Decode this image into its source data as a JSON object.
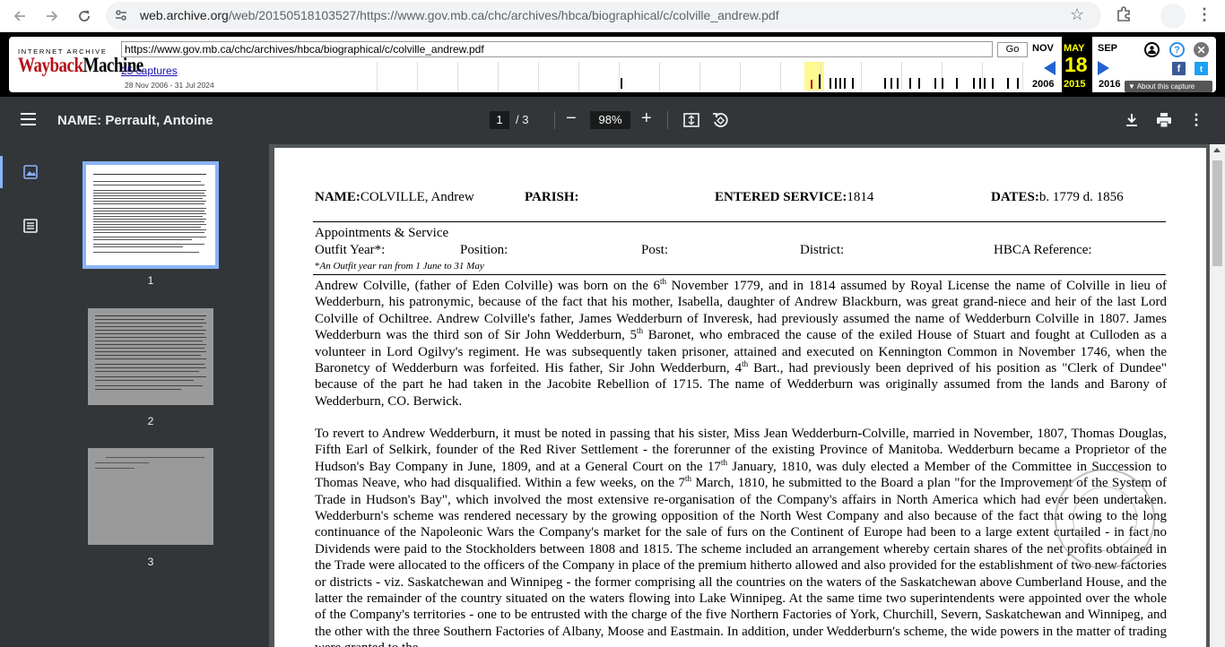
{
  "browser": {
    "url_host": "web.archive.org",
    "url_path": "/web/20150518103527/https://www.gov.mb.ca/chc/archives/hbca/biographical/c/colville_andrew.pdf"
  },
  "wayback": {
    "ia_label": "INTERNET ARCHIVE",
    "logo_red": "Wayback",
    "logo_black": "Machine",
    "url_value": "https://www.gov.mb.ca/chc/archives/hbca/biographical/c/colville_andrew.pdf",
    "go_label": "Go",
    "captures_label": "25 captures",
    "range_label": "28 Nov 2006 - 31 Jul 2024",
    "prev_month": "NOV",
    "cur_month": "MAY",
    "next_month": "SEP",
    "prev_year": "2006",
    "cur_day": "18",
    "cur_year": "2015",
    "next_year": "2016",
    "about_label": "▼ About this capture"
  },
  "pdf_toolbar": {
    "title": "NAME: Perrault, Antoine",
    "current_page": "1",
    "page_total": "/  3",
    "zoom": "98%"
  },
  "sidebar": {
    "thumbs": [
      {
        "num": "1"
      },
      {
        "num": "2"
      },
      {
        "num": "3"
      }
    ]
  },
  "document": {
    "name_label": "NAME:",
    "name_value": "COLVILLE, Andrew",
    "parish_label": "PARISH:",
    "entered_label": "ENTERED SERVICE:",
    "entered_value": "1814",
    "dates_label": "DATES:",
    "dates_value": "b. 1779 d. 1856",
    "appointments": "Appointments & Service",
    "col_outfit": "Outfit Year*:",
    "col_position": "Position:",
    "col_post": "Post:",
    "col_district": "District:",
    "col_ref": "HBCA Reference:",
    "note_ast": "*",
    "note": "An Outfit year ran from 1 June to 31 May",
    "p1": [
      "Andrew Colville, (father of Eden Colville) was born on the 6",
      "th",
      " November 1779, and in 1814 assumed by Royal License the name of Colville in lieu of Wedderburn, his patronymic, because of the fact that his mother, Isabella, daughter of Andrew Blackburn, was great grand-niece and heir of the last Lord Colville of Ochiltree.  Andrew Colville's father, James Wedderburn of Inveresk, had previously assumed the name of Wedderburn Colville in 1807.  James Wedderburn was the third  son of Sir John Wedderburn, 5",
      "th",
      " Baronet, who embraced the cause of the exiled House of Stuart and fought at Culloden as a volunteer in Lord Ogilvy's regiment.  He was subsequently taken prisoner, attained and executed on Kennington Common in November 1746, when the Baronetcy of Wedderburn was forfeited.  His father, Sir John Wedderburn, 4",
      "th",
      " Bart., had previously been deprived of his position as \"Clerk of Dundee\" because of the part he had taken in the Jacobite Rebellion of 1715.  The name of Wedderburn was originally assumed from the lands and Barony of Wedderburn, CO.  Berwick."
    ],
    "p2": [
      "To revert to Andrew Wedderburn, it must be noted in passing that his sister, Miss Jean Wedderburn-Colville, married in November, 1807, Thomas Douglas, Fifth Earl of Selkirk, founder of the Red River Settlement - the forerunner of the existing Province of Manitoba.  Wedderburn became a Proprietor of the Hudson's Bay Company in June, 1809, and at a General Court on the 17",
      "th",
      " January, 1810, was duly elected a Member of the Committee in Succession to Thomas Neave, who had disqualified.  Within a few weeks, on the 7",
      "th",
      " March, 1810, he submitted to the Board a plan \"for the Improvement of the System of Trade in Hudson's Bay\", which involved the most extensive re-organisation of the Company's affairs in North America which had ever been undertaken.  Wedderburn's scheme was rendered necessary by the growing opposition of the North West Company and also because of the fact that owing to the long continuance of the Napoleonic Wars the Company's market for the sale of furs on the Continent of Europe had been to a large extent curtailed - in fact no Dividends were paid to the Stockholders between 1808 and 1815.  The scheme included an arrangement whereby certain shares of the net profits obtained in the Trade were allocated to the officers of the Company in place of the premium hitherto allowed and also provided for the establishment of two new factories or districts - viz.  Saskatchewan and Winnipeg - the former comprising all the countries on the waters of the Saskatchewan above Cumberland House, and the latter the remainder of the country situated on the waters flowing into Lake Winnipeg.  At the same time two superintendents were appointed over the whole of the Company's territories - one to be entrusted  with the charge of the five Northern Factories of York, Churchill, Severn, Saskatchewan and Winnipeg, and the other with the three Southern Factories of Albany, Moose and Eastmain.  In addition, under Wedderburn's scheme, the wide powers in the matter of trading were granted to the"
    ]
  }
}
